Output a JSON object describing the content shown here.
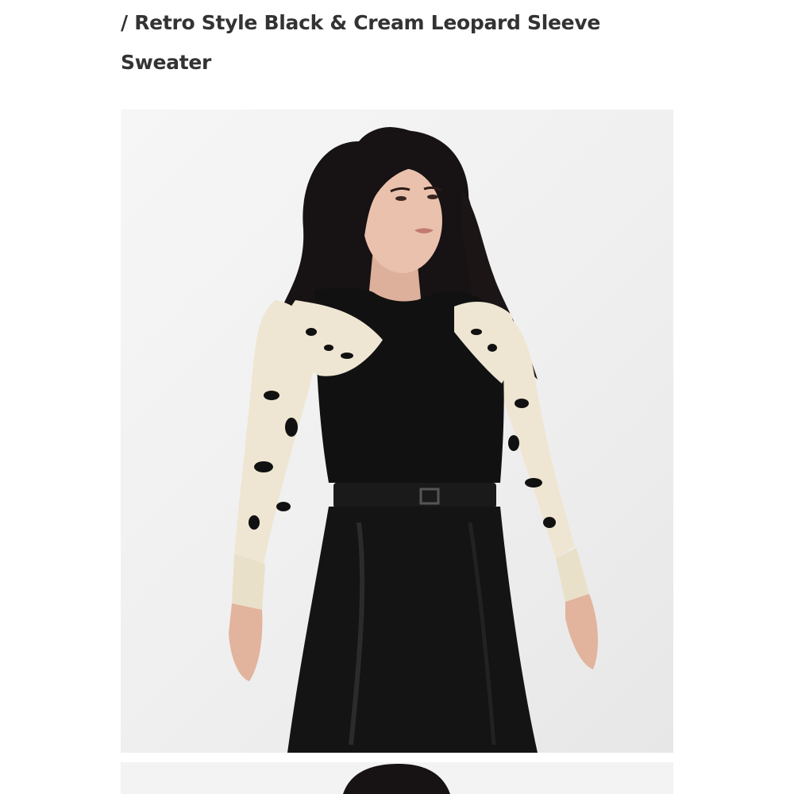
{
  "product": {
    "breadcrumb_title": "/ Retro Style Black & Cream Leopard Sleeve Sweater",
    "images": [
      {
        "alt": "Model wearing the Retro Style Black & Cream Leopard Sleeve Sweater with a black leather pencil skirt"
      },
      {
        "alt": "Next product photo"
      }
    ]
  },
  "colors": {
    "page_background": "#ffffff",
    "title_text": "#333333",
    "photo_background": "#f2f2f2",
    "sweater_black": "#111111",
    "leopard_cream": "#eee6d2",
    "hair": "#171213",
    "skin": "#e6bca6"
  }
}
